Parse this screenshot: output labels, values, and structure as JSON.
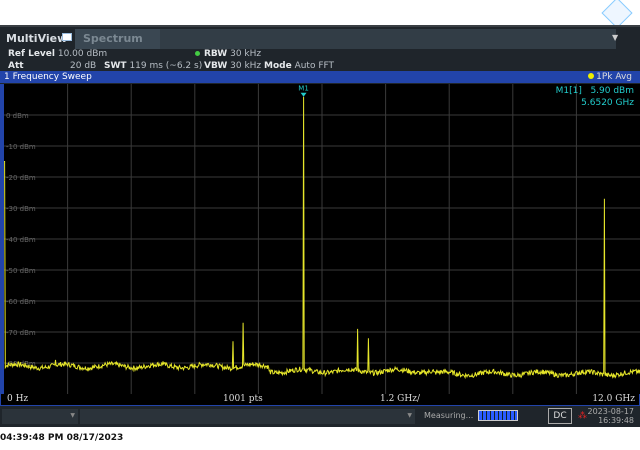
{
  "tabs": {
    "multiview": "MultiView",
    "spectrum": "Spectrum"
  },
  "settings": {
    "ref_level_label": "Ref Level",
    "ref_level": "10.00 dBm",
    "att_label": "Att",
    "att": "20 dB",
    "swt_label": "SWT",
    "swt": "119 ms (~6.2 s)",
    "rbw_label": "RBW",
    "rbw": "30 kHz",
    "vbw_label": "VBW",
    "vbw": "30 kHz",
    "mode_label": "Mode",
    "mode": "Auto FFT"
  },
  "window": {
    "title": "1 Frequency Sweep",
    "trace_label": "1Pk Avg"
  },
  "marker": {
    "name": "M1",
    "label": "M1[1]",
    "level": "5.90 dBm",
    "freq": "5.6520 GHz"
  },
  "axis": {
    "start": "0 Hz",
    "points": "1001 pts",
    "span_per_div": "1.2 GHz/",
    "stop": "12.0 GHz",
    "y_labels": [
      "0 dBm",
      "-10 dBm",
      "-20 dBm",
      "-30 dBm",
      "-40 dBm",
      "-50 dBm",
      "-60 dBm",
      "-70 dBm",
      "-80 dBm"
    ]
  },
  "status": {
    "measuring": "Measuring...",
    "coupling": "DC",
    "date": "2023-08-17",
    "time": "16:39:48",
    "progress": 0.9
  },
  "footer": "04:39:48 PM  08/17/2023",
  "colors": {
    "trace": "#e6e62a",
    "marker": "#22cccc",
    "bar": "#2244aa"
  },
  "chart_data": {
    "type": "line",
    "xlim_ghz": [
      0,
      12
    ],
    "ylim_dbm": [
      -90,
      10
    ],
    "floor": [
      {
        "from": 0,
        "to": 5.0,
        "dbm": -81
      },
      {
        "from": 5.0,
        "to": 8.1,
        "dbm": -82.6
      },
      {
        "from": 8.1,
        "to": 12,
        "dbm": -83.4
      }
    ],
    "peaks": [
      {
        "ghz": 0.97,
        "dbm": -79
      },
      {
        "ghz": 3.0,
        "dbm": -79.5
      },
      {
        "ghz": 4.32,
        "dbm": -73
      },
      {
        "ghz": 4.51,
        "dbm": -67
      },
      {
        "ghz": 5.652,
        "dbm": 5.9
      },
      {
        "ghz": 6.67,
        "dbm": -69
      },
      {
        "ghz": 6.88,
        "dbm": -72
      },
      {
        "ghz": 11.33,
        "dbm": -27
      }
    ]
  }
}
